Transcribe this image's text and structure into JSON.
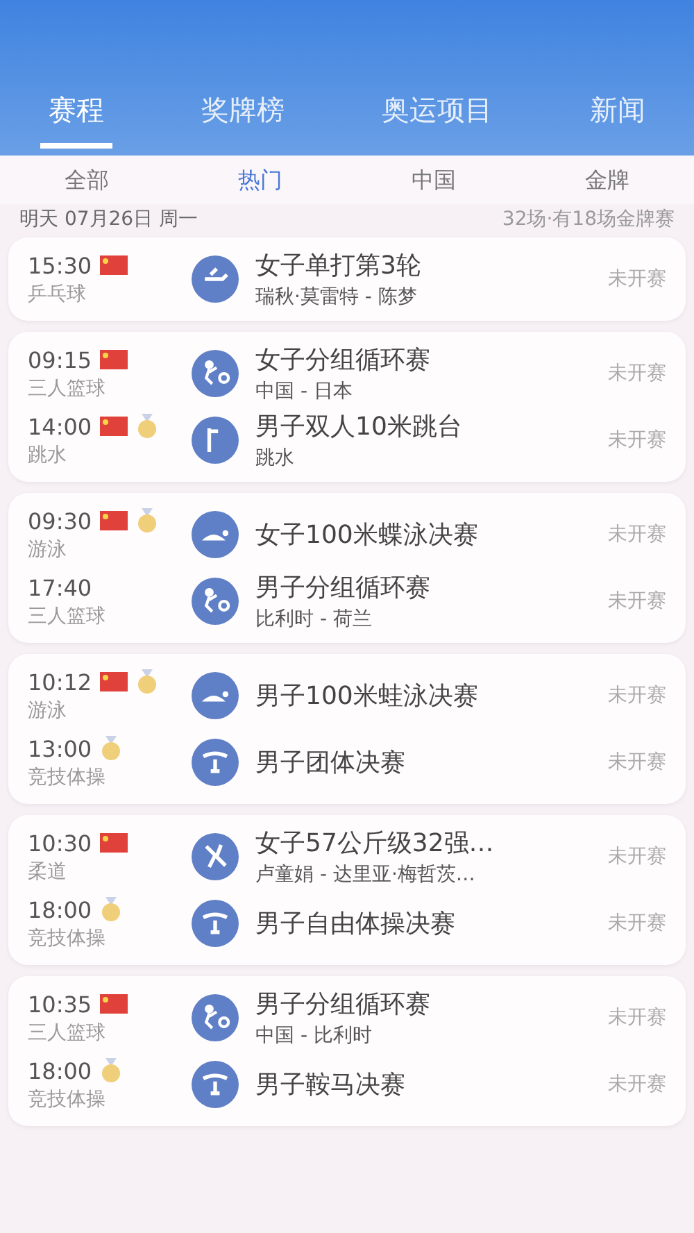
{
  "tabs": [
    {
      "label": "赛程",
      "selected": true
    },
    {
      "label": "奖牌榜",
      "selected": false
    },
    {
      "label": "奥运项目",
      "selected": false
    },
    {
      "label": "新闻",
      "selected": false
    }
  ],
  "filters": [
    {
      "label": "全部",
      "selected": false
    },
    {
      "label": "热门",
      "selected": true
    },
    {
      "label": "中国",
      "selected": false
    },
    {
      "label": "金牌",
      "selected": false
    }
  ],
  "date": "明天 07月26日 周一",
  "summary": "32场·有18场金牌赛",
  "cards": [
    {
      "events": [
        {
          "time": "15:30",
          "china": true,
          "medal": false,
          "sport": "乒乓球",
          "title": "女子单打第3轮",
          "subtitle": "瑞秋·莫雷特 - 陈梦",
          "status": "未开赛",
          "kind": "table-tennis"
        }
      ]
    },
    {
      "events": [
        {
          "time": "09:15",
          "china": true,
          "medal": false,
          "sport": "三人篮球",
          "title": "女子分组循环赛",
          "subtitle": "中国 - 日本",
          "status": "未开赛",
          "kind": "basketball"
        },
        {
          "time": "14:00",
          "china": true,
          "medal": true,
          "sport": "跳水",
          "title": "男子双人10米跳台",
          "subtitle": "跳水",
          "status": "未开赛",
          "kind": "diving"
        }
      ]
    },
    {
      "events": [
        {
          "time": "09:30",
          "china": true,
          "medal": true,
          "sport": "游泳",
          "title": "女子100米蝶泳决赛",
          "status": "未开赛",
          "kind": "swimming"
        },
        {
          "time": "17:40",
          "china": false,
          "medal": false,
          "sport": "三人篮球",
          "title": "男子分组循环赛",
          "subtitle": "比利时 - 荷兰",
          "status": "未开赛",
          "kind": "basketball"
        }
      ]
    },
    {
      "events": [
        {
          "time": "10:12",
          "china": true,
          "medal": true,
          "sport": "游泳",
          "title": "男子100米蛙泳决赛",
          "status": "未开赛",
          "kind": "swimming"
        },
        {
          "time": "13:00",
          "china": false,
          "medal": true,
          "sport": "竞技体操",
          "title": "男子团体决赛",
          "status": "未开赛",
          "kind": "gymnastics"
        }
      ]
    },
    {
      "events": [
        {
          "time": "10:30",
          "china": true,
          "medal": false,
          "sport": "柔道",
          "title": "女子57公斤级32强…",
          "subtitle": "卢童娟 - 达里亚·梅哲茨…",
          "status": "未开赛",
          "kind": "judo"
        },
        {
          "time": "18:00",
          "china": false,
          "medal": true,
          "sport": "竞技体操",
          "title": "男子自由体操决赛",
          "status": "未开赛",
          "kind": "gymnastics"
        }
      ]
    },
    {
      "events": [
        {
          "time": "10:35",
          "china": true,
          "medal": false,
          "sport": "三人篮球",
          "title": "男子分组循环赛",
          "subtitle": "中国 - 比利时",
          "status": "未开赛",
          "kind": "basketball"
        },
        {
          "time": "18:00",
          "china": false,
          "medal": true,
          "sport": "竞技体操",
          "title": "男子鞍马决赛",
          "status": "未开赛",
          "kind": "gymnastics"
        }
      ]
    }
  ]
}
